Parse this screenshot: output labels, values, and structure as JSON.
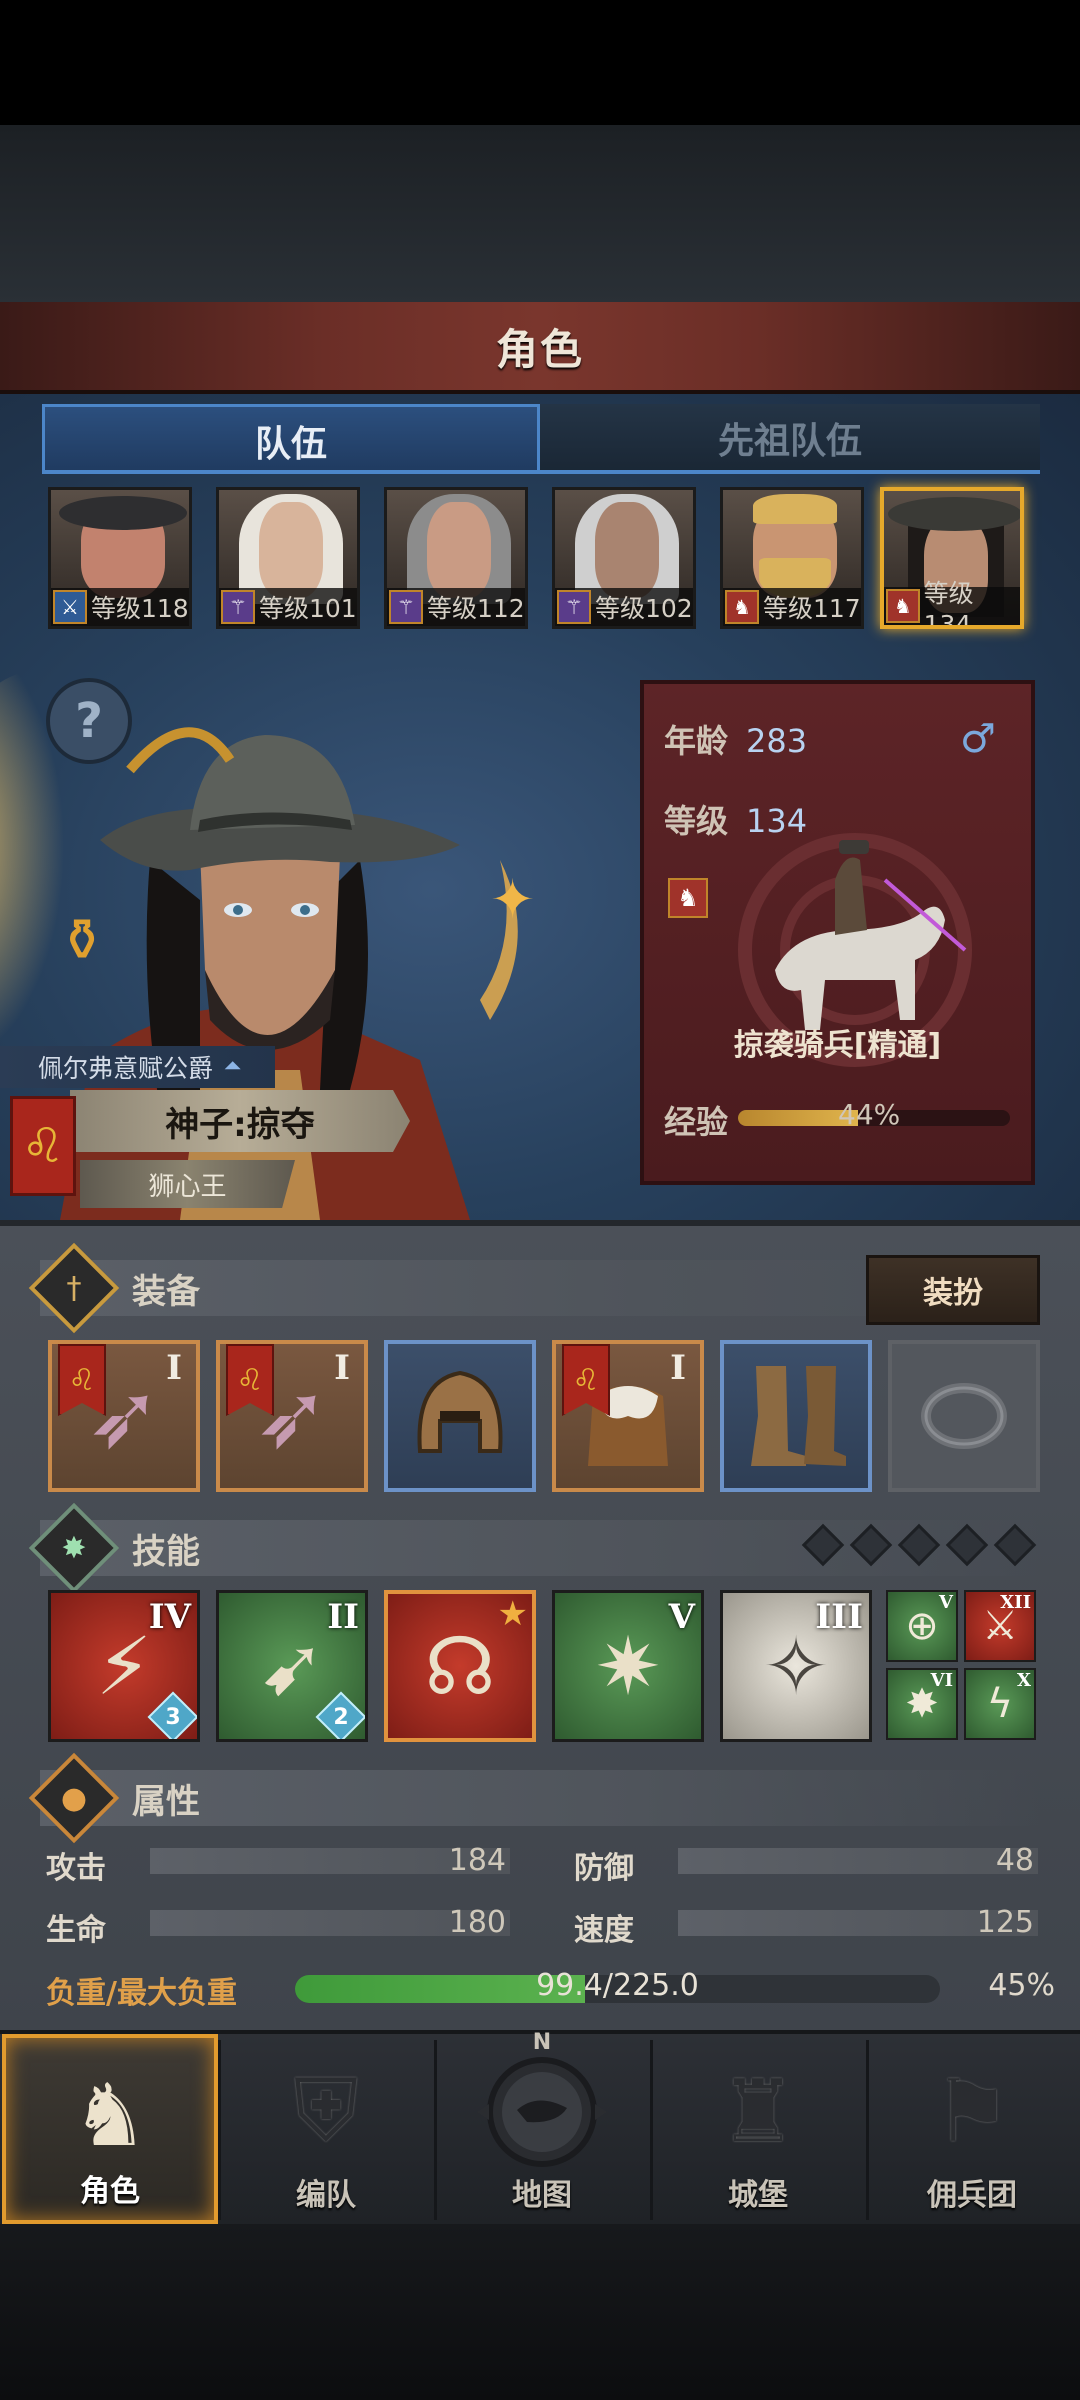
{
  "title": "角色",
  "tabs": [
    {
      "label": "队伍",
      "active": true
    },
    {
      "label": "先祖队伍",
      "active": false
    }
  ],
  "portraits": [
    {
      "level": "等级118",
      "class_icon": "sword-icon",
      "skin": "#c2826e",
      "hair": "#3b3b3b"
    },
    {
      "level": "等级101",
      "class_icon": "staff-icon",
      "skin": "#d8b49b",
      "hair": "#e8e4dc"
    },
    {
      "level": "等级112",
      "class_icon": "staff-icon",
      "skin": "#c99b84",
      "hair": "#8c8c8c"
    },
    {
      "level": "等级102",
      "class_icon": "staff-icon",
      "skin": "#a98470",
      "hair": "#cfcfcf"
    },
    {
      "level": "等级117",
      "class_icon": "horse-icon",
      "skin": "#c99572",
      "hair": "#d9b25c"
    },
    {
      "level": "等级134",
      "class_icon": "horse-icon",
      "skin": "#b88c72",
      "hair": "#1e1a18",
      "selected": true
    }
  ],
  "hero": {
    "title": "佩尔弗意赋公爵",
    "name": "神子:掠夺",
    "subtitle": "狮心王"
  },
  "info": {
    "age_label": "年龄",
    "age": "283",
    "level_label": "等级",
    "level": "134",
    "unit_class": "掠袭骑兵[精通]",
    "exp_label": "经验",
    "exp_text": "44%",
    "exp_fraction": 0.44
  },
  "equipment": {
    "title": "装备",
    "dress_button": "装扮",
    "slots": [
      {
        "tier": "I",
        "type": "bow",
        "rarity": "orange",
        "flag": true
      },
      {
        "tier": "I",
        "type": "bow",
        "rarity": "orange",
        "flag": true
      },
      {
        "tier": "",
        "type": "helmet",
        "rarity": "blue",
        "flag": false
      },
      {
        "tier": "I",
        "type": "armor",
        "rarity": "orange",
        "flag": true
      },
      {
        "tier": "",
        "type": "boots",
        "rarity": "blue",
        "flag": false
      },
      {
        "tier": "",
        "type": "ring",
        "rarity": "empty",
        "flag": false
      }
    ]
  },
  "skills": {
    "title": "技能",
    "items": [
      {
        "tier": "IV",
        "color": "red",
        "gem": "3"
      },
      {
        "tier": "II",
        "color": "green",
        "gem": "2"
      },
      {
        "tier": "",
        "color": "red",
        "star": true
      },
      {
        "tier": "V",
        "color": "green"
      },
      {
        "tier": "III",
        "color": "white"
      }
    ],
    "mini": [
      {
        "tier": "V",
        "color": "green"
      },
      {
        "tier": "XII",
        "color": "red"
      },
      {
        "tier": "VI",
        "color": "green"
      },
      {
        "tier": "X",
        "color": "green"
      }
    ]
  },
  "attributes": {
    "title": "属性",
    "attack_label": "攻击",
    "attack": "184",
    "defense_label": "防御",
    "defense": "48",
    "hp_label": "生命",
    "hp": "180",
    "speed_label": "速度",
    "speed": "125",
    "load_label": "负重/最大负重",
    "load_text": "99.4/225.0",
    "load_pct": "45%",
    "load_fraction": 0.45
  },
  "nav": [
    {
      "label": "角色",
      "icon": "knight-icon",
      "active": true
    },
    {
      "label": "编队",
      "icon": "helmet-icon",
      "active": false
    },
    {
      "label": "地图",
      "icon": "compass-icon",
      "active": false
    },
    {
      "label": "城堡",
      "icon": "castle-icon",
      "active": false
    },
    {
      "label": "佣兵团",
      "icon": "banner-icon",
      "active": false
    }
  ],
  "compass_n": "N",
  "colors": {
    "accent": "#e29b2e",
    "tab_border": "#4c86c9",
    "card": "#5d2427"
  }
}
